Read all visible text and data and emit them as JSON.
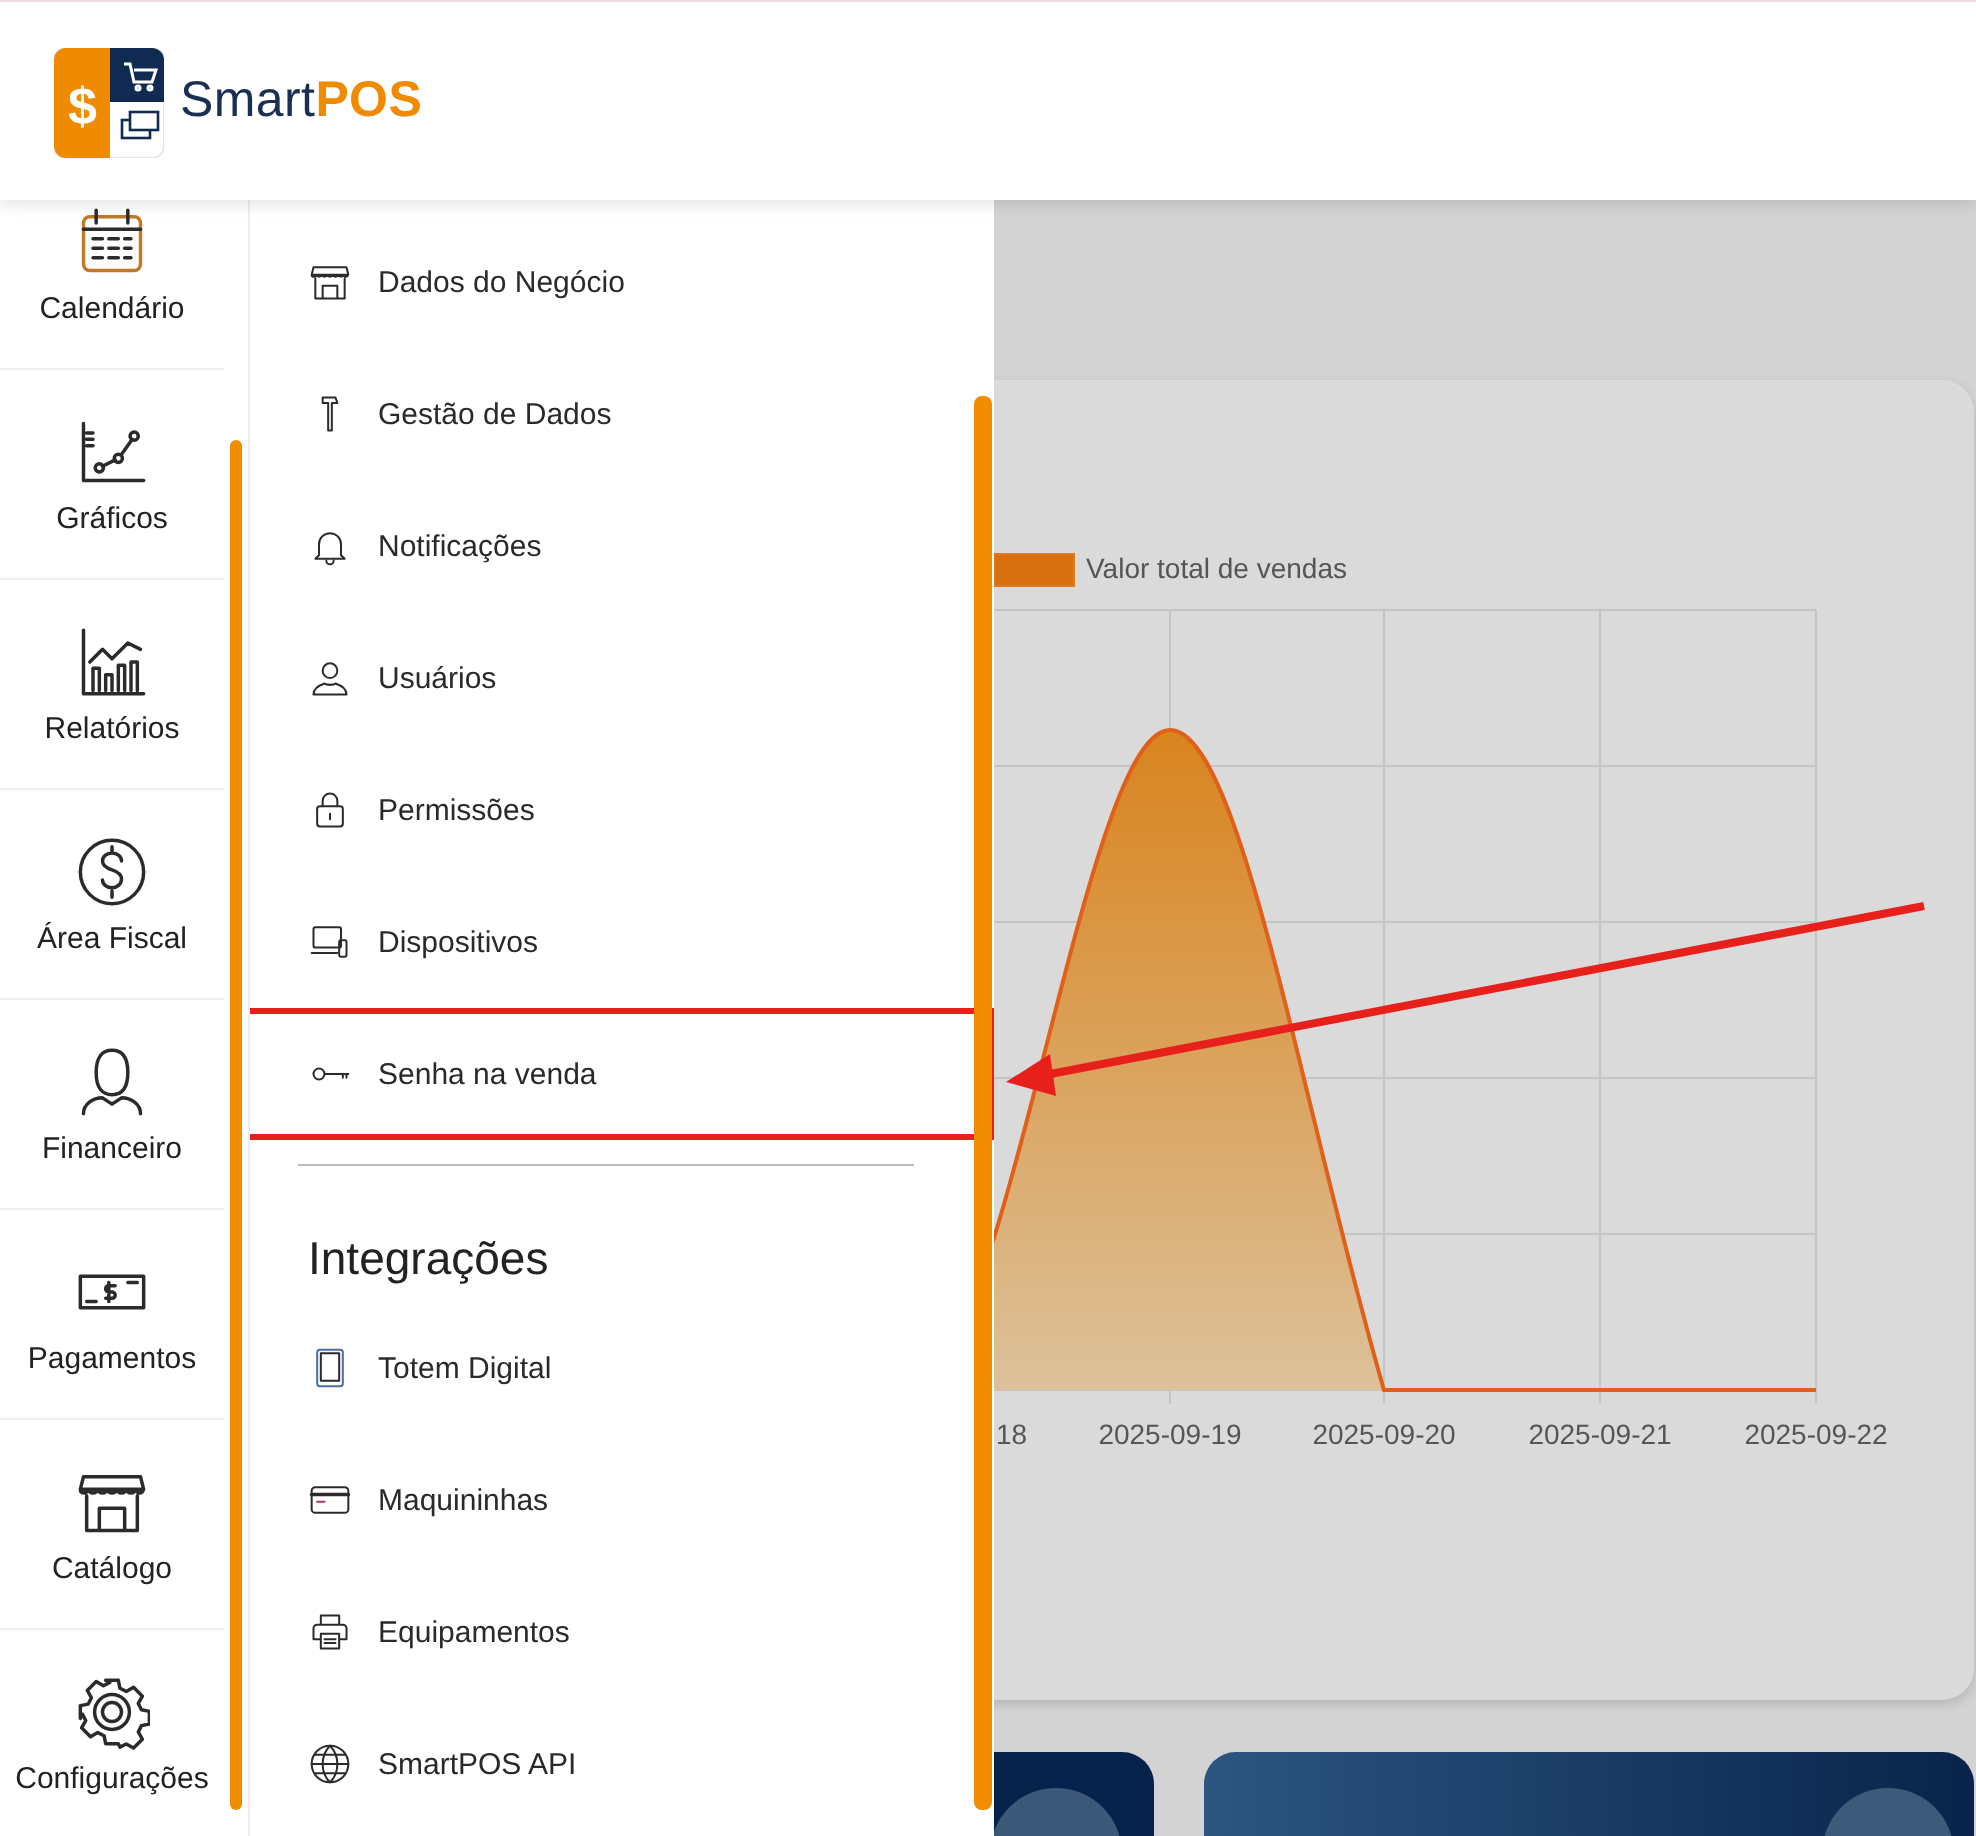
{
  "logo_symbol": "$",
  "brand_parts": [
    "Smart",
    "POS"
  ],
  "rail": [
    {
      "label": "Calendário"
    },
    {
      "label": "Gráficos"
    },
    {
      "label": "Relatórios"
    },
    {
      "label": "Área Fiscal"
    },
    {
      "label": "Financeiro"
    },
    {
      "label": "Pagamentos"
    },
    {
      "label": "Catálogo"
    },
    {
      "label": "Configurações"
    }
  ],
  "menu": [
    {
      "label": "Dados do Negócio",
      "highlighted": false
    },
    {
      "label": "Gestão de Dados",
      "highlighted": false
    },
    {
      "label": "Notificações",
      "highlighted": false
    },
    {
      "label": "Usuários",
      "highlighted": false
    },
    {
      "label": "Permissões",
      "highlighted": false
    },
    {
      "label": "Dispositivos",
      "highlighted": false
    },
    {
      "label": "Senha na venda",
      "highlighted": true
    }
  ],
  "integrations": {
    "title": "Integrações",
    "items": [
      {
        "label": "Totem Digital"
      },
      {
        "label": "Maquininhas"
      },
      {
        "label": "Equipamentos"
      },
      {
        "label": "SmartPOS API"
      }
    ]
  },
  "chart": {
    "legend": "Valor total de vendas",
    "x_labels": [
      "18",
      "2025-09-19",
      "2025-09-20",
      "2025-09-21",
      "2025-09-22"
    ]
  }
}
